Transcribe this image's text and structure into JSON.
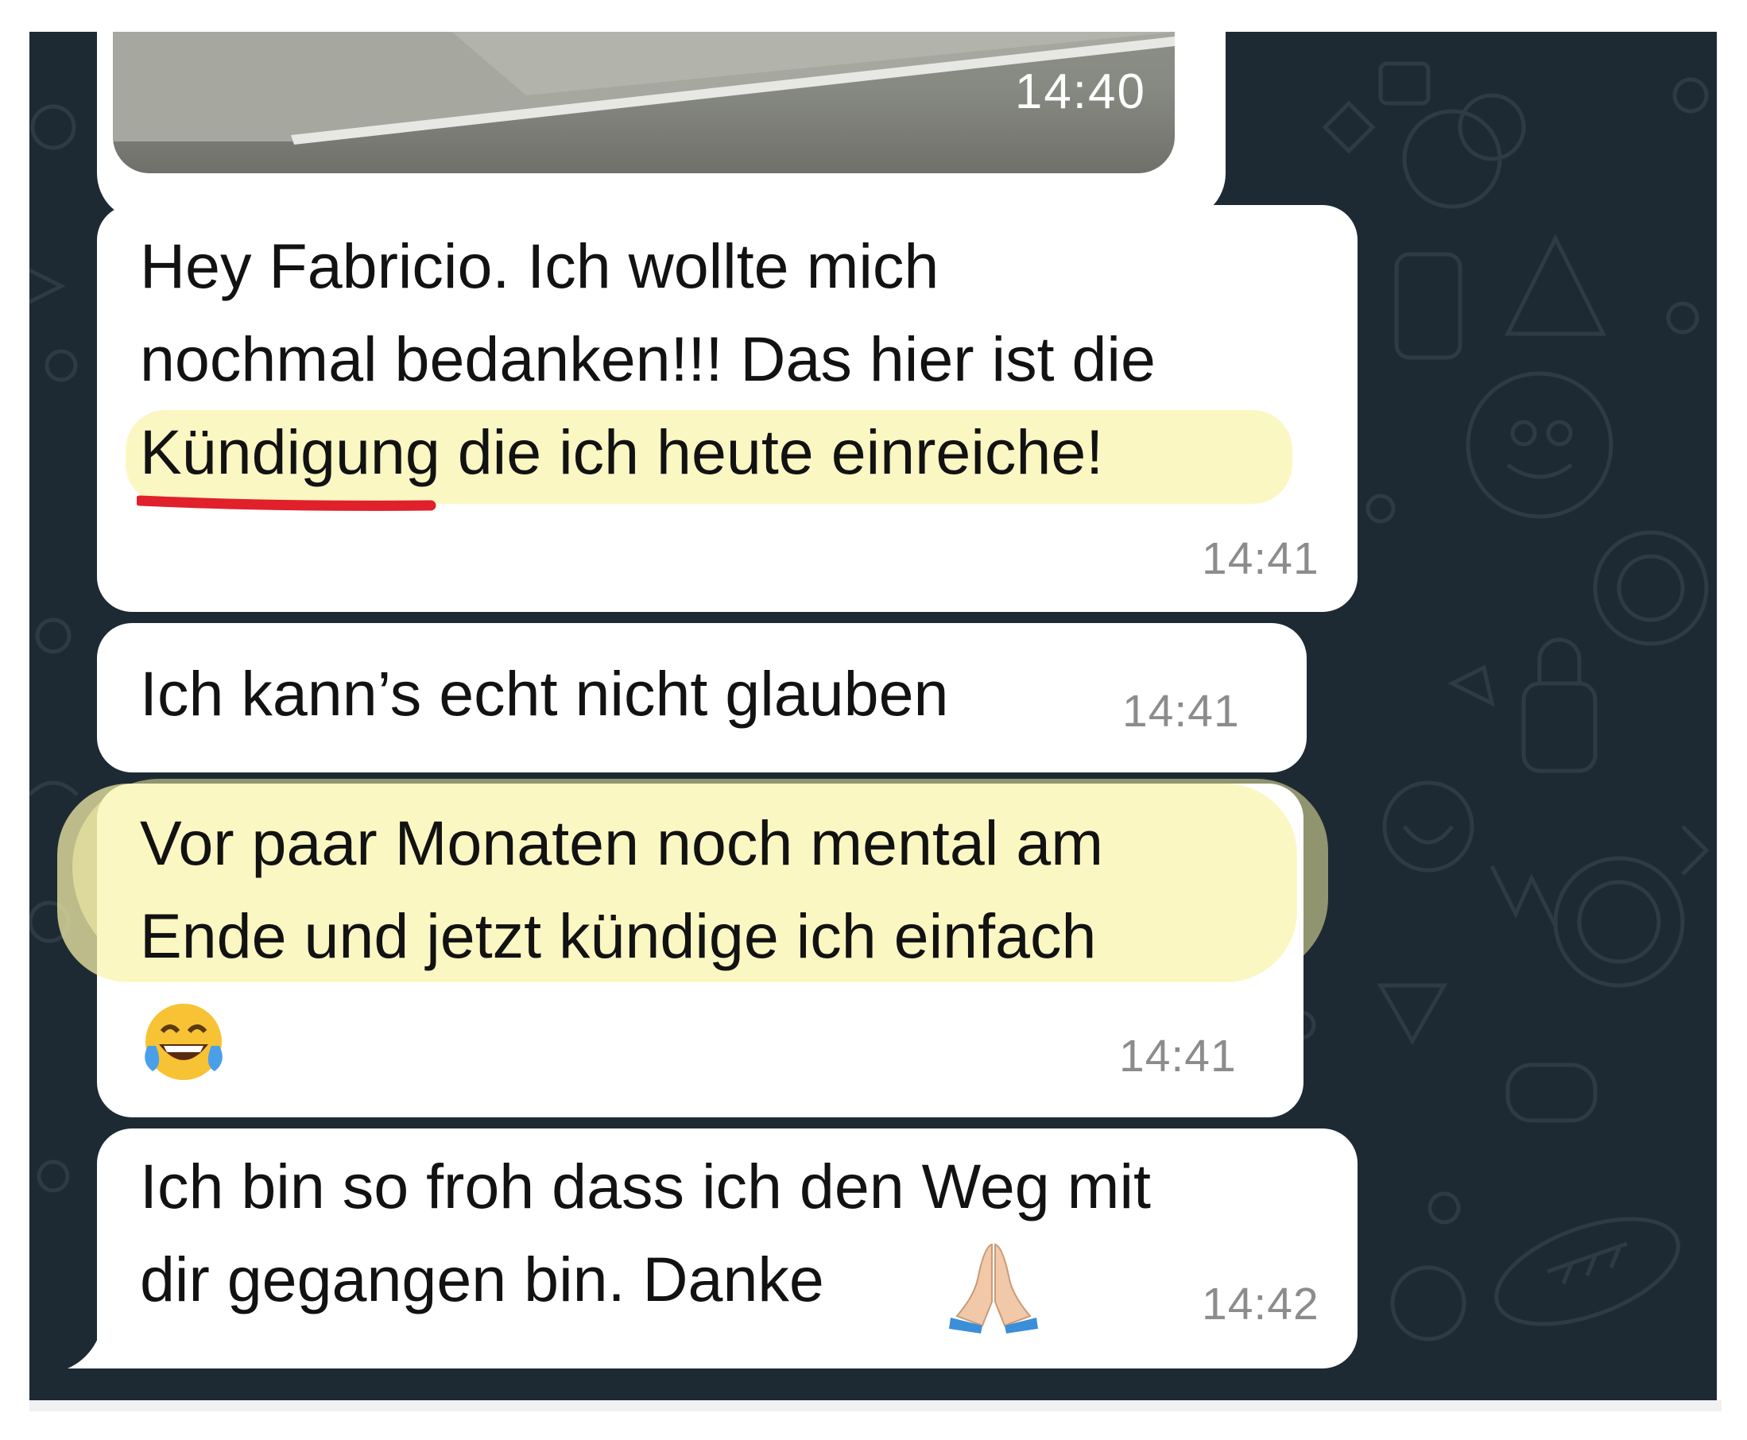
{
  "messages": [
    {
      "type": "image",
      "time": "14:40"
    },
    {
      "type": "text",
      "lines": [
        "Hey Fabricio. Ich wollte mich",
        "nochmal bedanken!!! Das hier ist die",
        "Kündigung die ich heute einreiche!"
      ],
      "time": "14:41"
    },
    {
      "type": "text",
      "lines": [
        "Ich kann’s echt nicht glauben"
      ],
      "time": "14:41"
    },
    {
      "type": "text",
      "lines": [
        "Vor paar Monaten noch mental am",
        "Ende und jetzt kündige ich einfach"
      ],
      "emoji": "face-with-tears-of-joy",
      "time": "14:41"
    },
    {
      "type": "text",
      "lines": [
        "Ich bin so froh dass ich den Weg mit",
        "dir gegangen bin. Danke"
      ],
      "emoji": "folded-hands",
      "time": "14:42"
    }
  ],
  "colors": {
    "chat_background": "#1e2a33",
    "bubble": "#ffffff",
    "highlight": "#faf4aa",
    "underline": "#e0202a",
    "timestamp": "#8c8c8c"
  }
}
